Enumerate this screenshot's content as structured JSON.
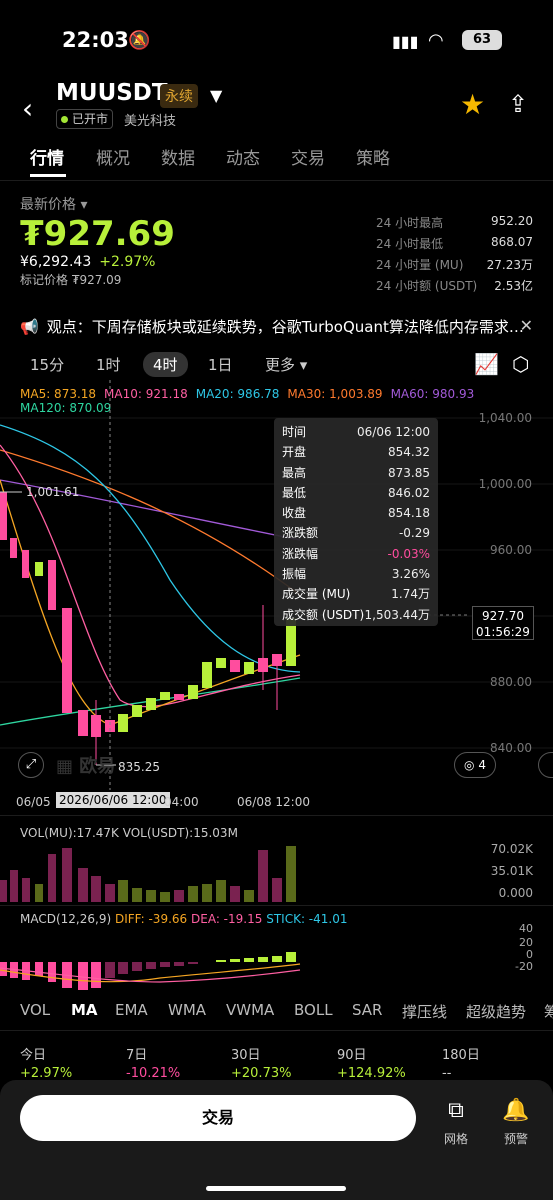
{
  "status": {
    "time": "22:03",
    "battery": "63"
  },
  "header": {
    "symbol": "MUUSDT",
    "badge": "永续",
    "market_status": "已开市",
    "company": "美光科技"
  },
  "tabs": [
    "行情",
    "概况",
    "数据",
    "动态",
    "交易",
    "策略"
  ],
  "price": {
    "label": "最新价格 ▾",
    "last": "₮927.69",
    "fiat": "¥6,292.43",
    "change": "+2.97%",
    "mark": "标记价格 ₮927.09",
    "stats": [
      {
        "k": "24 小时最高",
        "v": "952.20"
      },
      {
        "k": "24 小时最低",
        "v": "868.07"
      },
      {
        "k": "24 小时量 (MU)",
        "v": "27.23万"
      },
      {
        "k": "24 小时额 (USDT)",
        "v": "2.53亿"
      }
    ]
  },
  "news": {
    "text": "观点：下周存储板块或延续跌势，谷歌TurboQuant算法降低内存需求…"
  },
  "intervals": {
    "m15": "15分",
    "h1": "1时",
    "h4": "4时",
    "d1": "1日",
    "more": "更多 ▾"
  },
  "ma_legend": {
    "ma5": "MA5: 873.18",
    "ma10": "MA10: 921.18",
    "ma20": "MA20: 986.78",
    "ma30": "MA30: 1,003.89",
    "ma60": "MA60: 980.93",
    "ma120": "MA120: 870.09"
  },
  "price_axis": [
    "1,040.00",
    "1,000.00",
    "960.00",
    "880.00",
    "840.00"
  ],
  "tooltip": [
    {
      "k": "时间",
      "v": "06/06 12:00"
    },
    {
      "k": "开盘",
      "v": "854.32"
    },
    {
      "k": "最高",
      "v": "873.85"
    },
    {
      "k": "最低",
      "v": "846.02"
    },
    {
      "k": "收盘",
      "v": "854.18"
    },
    {
      "k": "涨跌额",
      "v": "-0.29"
    },
    {
      "k": "涨跌幅",
      "v": "-0.03%"
    },
    {
      "k": "振幅",
      "v": "3.26%"
    },
    {
      "k": "成交量 (MU)",
      "v": "1.74万"
    },
    {
      "k": "成交额 (USDT)",
      "v": "1,503.44万"
    }
  ],
  "current_price": {
    "price": "927.70",
    "countdown": "01:56:29"
  },
  "high_marker": "1,001.61",
  "low_marker": "835.25",
  "draw_count": "4",
  "x_axis": {
    "left": "06/05",
    "selected": "2026/06/06 12:00",
    "mid": "04:00",
    "right": "06/08 12:00"
  },
  "vol": {
    "legend": "VOL(MU):17.47K VOL(USDT):15.03M",
    "axis": [
      "70.02K",
      "35.01K",
      "0.000"
    ]
  },
  "macd": {
    "name": "MACD(12,26,9)",
    "diff": "DIFF: -39.66",
    "dea": "DEA: -19.15",
    "stick": "STICK: -41.01",
    "axis": [
      "40",
      "20",
      "0",
      "-20"
    ]
  },
  "indicators": [
    "VOL",
    "MA",
    "EMA",
    "WMA",
    "VWMA",
    "BOLL",
    "SAR",
    "撑压线",
    "超级趋势",
    "筹"
  ],
  "periods": [
    {
      "label": "今日",
      "value": "+2.97%",
      "color": "#b8f03a"
    },
    {
      "label": "7日",
      "value": "-10.21%",
      "color": "#ff4d9e"
    },
    {
      "label": "30日",
      "value": "+20.73%",
      "color": "#b8f03a"
    },
    {
      "label": "90日",
      "value": "+124.92%",
      "color": "#b8f03a"
    },
    {
      "label": "180日",
      "value": "--",
      "color": "#ccc"
    }
  ],
  "bottom": {
    "trade": "交易",
    "grid": "网格",
    "alert": "预警"
  },
  "colors": {
    "up": "#b8f03a",
    "down": "#ff4d9e",
    "ma5": "#f5a623",
    "ma10": "#ff5fa2",
    "ma20": "#2ec7e6",
    "ma30": "#ff7a2e",
    "ma60": "#a25ad8",
    "ma120": "#2ed6a0"
  }
}
